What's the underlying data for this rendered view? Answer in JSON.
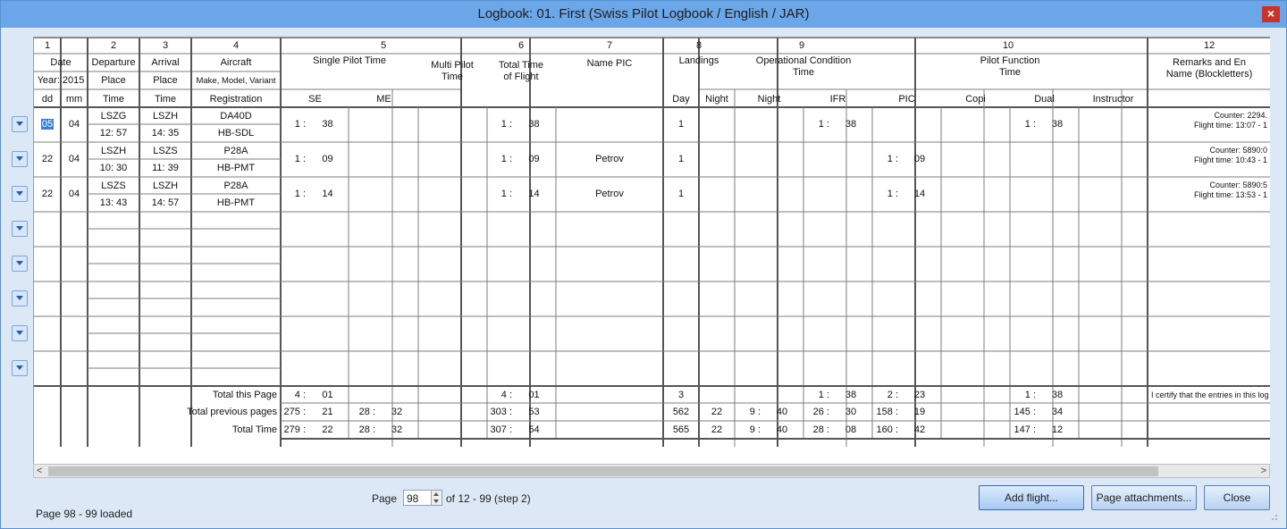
{
  "window": {
    "title": "Logbook: 01. First (Swiss Pilot Logbook / English / JAR)",
    "close_label": "×"
  },
  "columns": {
    "numbers": [
      "1",
      "2",
      "3",
      "4",
      "5",
      "6",
      "7",
      "8",
      "9",
      "10",
      "12"
    ],
    "date": {
      "title": "Date",
      "year": "Year: 2015",
      "dd": "dd",
      "mm": "mm"
    },
    "departure": {
      "title": "Departure",
      "place": "Place",
      "time": "Time"
    },
    "arrival": {
      "title": "Arrival",
      "place": "Place",
      "time": "Time"
    },
    "aircraft": {
      "title": "Aircraft",
      "make": "Make, Model, Variant",
      "registration": "Registration"
    },
    "single_pilot": {
      "title": "Single Pilot Time",
      "se": "SE",
      "me": "ME"
    },
    "multi_pilot": {
      "line1": "Multi Pilot",
      "line2": "Time"
    },
    "total_time": {
      "line1": "Total Time",
      "line2": "of Flight"
    },
    "name_pic": "Name PIC",
    "landings": {
      "title": "Landings",
      "day": "Day",
      "night": "Night"
    },
    "operational": {
      "line1": "Operational Condition",
      "line2": "Time",
      "night": "Night",
      "ifr": "IFR"
    },
    "pilot_function": {
      "line1": "Pilot Function",
      "line2": "Time",
      "pic": "PIC",
      "copi": "Copi",
      "dual": "Dual",
      "instructor": "Instructor"
    },
    "remarks": {
      "line1": "Remarks and En",
      "line2": "Name (Blockletters)"
    }
  },
  "flights": [
    {
      "dd": "05",
      "mm": "04",
      "dep_place": "LSZG",
      "dep_time_h": "12",
      "dep_time_m": "57",
      "arr_place": "LSZH",
      "arr_time_h": "14",
      "arr_time_m": "35",
      "aircraft": "DA40D",
      "registration": "HB-SDL",
      "se_h": "1 :",
      "se_m": "38",
      "total_h": "1 :",
      "total_m": "38",
      "name_pic": "",
      "land_day": "1",
      "ifr_h": "1 :",
      "ifr_m": "38",
      "pic_h": "",
      "pic_m": "",
      "dual_h": "1 :",
      "dual_m": "38",
      "remark1": "Counter: 2294.",
      "remark2": "Flight time: 13:07 - 1"
    },
    {
      "dd": "22",
      "mm": "04",
      "dep_place": "LSZH",
      "dep_time_h": "10",
      "dep_time_m": "30",
      "arr_place": "LSZS",
      "arr_time_h": "11",
      "arr_time_m": "39",
      "aircraft": "P28A",
      "registration": "HB-PMT",
      "se_h": "1 :",
      "se_m": "09",
      "total_h": "1 :",
      "total_m": "09",
      "name_pic": "Petrov",
      "land_day": "1",
      "ifr_h": "",
      "ifr_m": "",
      "pic_h": "1 :",
      "pic_m": "09",
      "dual_h": "",
      "dual_m": "",
      "remark1": "Counter: 5890:0",
      "remark2": "Flight time: 10:43 - 1"
    },
    {
      "dd": "22",
      "mm": "04",
      "dep_place": "LSZS",
      "dep_time_h": "13",
      "dep_time_m": "43",
      "arr_place": "LSZH",
      "arr_time_h": "14",
      "arr_time_m": "57",
      "aircraft": "P28A",
      "registration": "HB-PMT",
      "se_h": "1 :",
      "se_m": "14",
      "total_h": "1 :",
      "total_m": "14",
      "name_pic": "Petrov",
      "land_day": "1",
      "ifr_h": "",
      "ifr_m": "",
      "pic_h": "1 :",
      "pic_m": "14",
      "dual_h": "",
      "dual_m": "",
      "remark1": "Counter: 5890:5",
      "remark2": "Flight time: 13:53 - 1"
    }
  ],
  "totals": [
    {
      "label": "Total this Page",
      "se_h": "4 :",
      "se_m": "01",
      "me_h": "",
      "me_m": "",
      "total_h": "4 :",
      "total_m": "01",
      "land_day": "3",
      "land_night": "",
      "night_h": "",
      "night_m": "",
      "ifr_h": "1 :",
      "ifr_m": "38",
      "pic_h": "2 :",
      "pic_m": "23",
      "dual_h": "1 :",
      "dual_m": "38"
    },
    {
      "label": "Total previous pages",
      "se_h": "275 :",
      "se_m": "21",
      "me_h": "28 :",
      "me_m": "32",
      "total_h": "303 :",
      "total_m": "53",
      "land_day": "562",
      "land_night": "22",
      "night_h": "9 :",
      "night_m": "40",
      "ifr_h": "26 :",
      "ifr_m": "30",
      "pic_h": "158 :",
      "pic_m": "19",
      "dual_h": "145 :",
      "dual_m": "34"
    },
    {
      "label": "Total Time",
      "se_h": "279 :",
      "se_m": "22",
      "me_h": "28 :",
      "me_m": "32",
      "total_h": "307 :",
      "total_m": "54",
      "land_day": "565",
      "land_night": "22",
      "night_h": "9 :",
      "night_m": "40",
      "ifr_h": "28 :",
      "ifr_m": "08",
      "pic_h": "160 :",
      "pic_m": "42",
      "dual_h": "147 :",
      "dual_m": "12"
    }
  ],
  "certify_text": "I certify that the entries in this log",
  "pager": {
    "label": "Page",
    "value": "98",
    "range": "of 12 - 99 (step 2)"
  },
  "buttons": {
    "add_flight": "Add flight...",
    "attachments": "Page attachments...",
    "close": "Close"
  },
  "status": "Page 98 - 99 loaded",
  "colors": {
    "accent": "#3a7fd5",
    "titlebar": "#6aa6e8",
    "close": "#c9332b"
  }
}
